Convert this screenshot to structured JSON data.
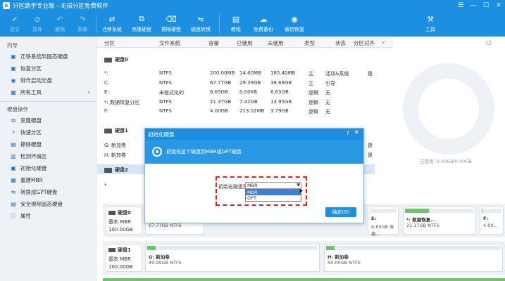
{
  "window": {
    "title": "分区助手专业版 - 无损分区免费软件",
    "logo": "A"
  },
  "toolbar": {
    "undo": "提交",
    "discard": "放弃",
    "redo": "撤销",
    "reapply": "重做",
    "migrate": "迁移系统",
    "clone": "克隆硬盘",
    "wipe": "擦除硬盘",
    "convert": "磁盘转换",
    "tutorial": "教程",
    "backup": "免费备份",
    "wechat": "微信恢复",
    "tools": "工具"
  },
  "sidebar": {
    "guide_head": "向导",
    "guide_items": [
      "迁移系统到固态硬盘",
      "恢复分区",
      "制作启动光盘",
      "所有工具"
    ],
    "ops_head": "硬盘操作",
    "ops_items": [
      "克隆硬盘",
      "快速分区",
      "擦除硬盘",
      "检测坏扇区",
      "初始化硬盘",
      "重建MBR",
      "转换成GPT硬盘",
      "安全擦除固态硬盘",
      "属性"
    ]
  },
  "table": {
    "headers": [
      "分区",
      "文件系统",
      "容量",
      "已使用",
      "未使用",
      "类型",
      "状态",
      "分区对齐"
    ],
    "disk0": "硬盘0",
    "rows0": [
      [
        "*:",
        "NTFS",
        "200.00MB",
        "14.60MB",
        "185.40MB",
        "主",
        "活动&系统",
        "是"
      ],
      [
        "C:",
        "NTFS",
        "67.77GB",
        "29.39GB",
        "38.68GB",
        "主",
        "引导",
        ""
      ],
      [
        "E:",
        "未格式化的",
        "6.65GB",
        "0.00KB",
        "6.65GB",
        "逻辑",
        "无",
        ""
      ],
      [
        "*: 数据恢复分区",
        "NTFS",
        "21.37GB",
        "7.42GB",
        "13.95GB",
        "逻辑",
        "无",
        ""
      ],
      [
        "F:",
        "NTFS",
        "4.00GB",
        "213.02MB",
        "3.79GB",
        "逻辑",
        "无",
        ""
      ]
    ],
    "disk1": "硬盘1",
    "rows1": [
      [
        "G: 新加卷",
        "是"
      ],
      [
        "H: 新加卷",
        "是"
      ]
    ],
    "disk2": "硬盘2",
    "row2": "*"
  },
  "right": {
    "free_label": "已使用: 0.00GB/0.00GB"
  },
  "diskmap": {
    "disk0": {
      "name": "硬盘0",
      "type": "基本 MBR",
      "size": "100.00GB"
    },
    "disk0_parts": [
      {
        "t1": "",
        "t2": "67.77GB NTFS",
        "fill": 0.43
      },
      {
        "t1": "E:",
        "t2": "6.65GB 未格...",
        "fill": 0.0
      },
      {
        "t1": "*: 数据恢复...",
        "t2": "21.37GB NTFS",
        "fill": 0.35
      },
      {
        "t1": "F:",
        "t2": "4.00...",
        "fill": 0.05
      }
    ],
    "disk1": {
      "name": "硬盘1",
      "type": "基本 MBR",
      "size": "100.00GB"
    },
    "disk1_parts": [
      {
        "t1": "G: 新加卷",
        "t2": "49.99GB NTFS",
        "fill": 0.05
      },
      {
        "t1": "H: 新加卷",
        "t2": "50.00GB NTFS",
        "fill": 0.05
      }
    ]
  },
  "dialog": {
    "title": "初始化硬盘",
    "help": "?",
    "close": "✕",
    "message": "初始化这个磁盘到MBR或GPT磁盘.",
    "init_label": "初始化磁盘到:",
    "selected": "MBR",
    "options": [
      "MBR",
      "GPT"
    ],
    "ok": "确定(O)"
  },
  "colors": {
    "accent": "#1d8fe0",
    "usage": "#6bc56b",
    "highlight": "#e02020"
  }
}
